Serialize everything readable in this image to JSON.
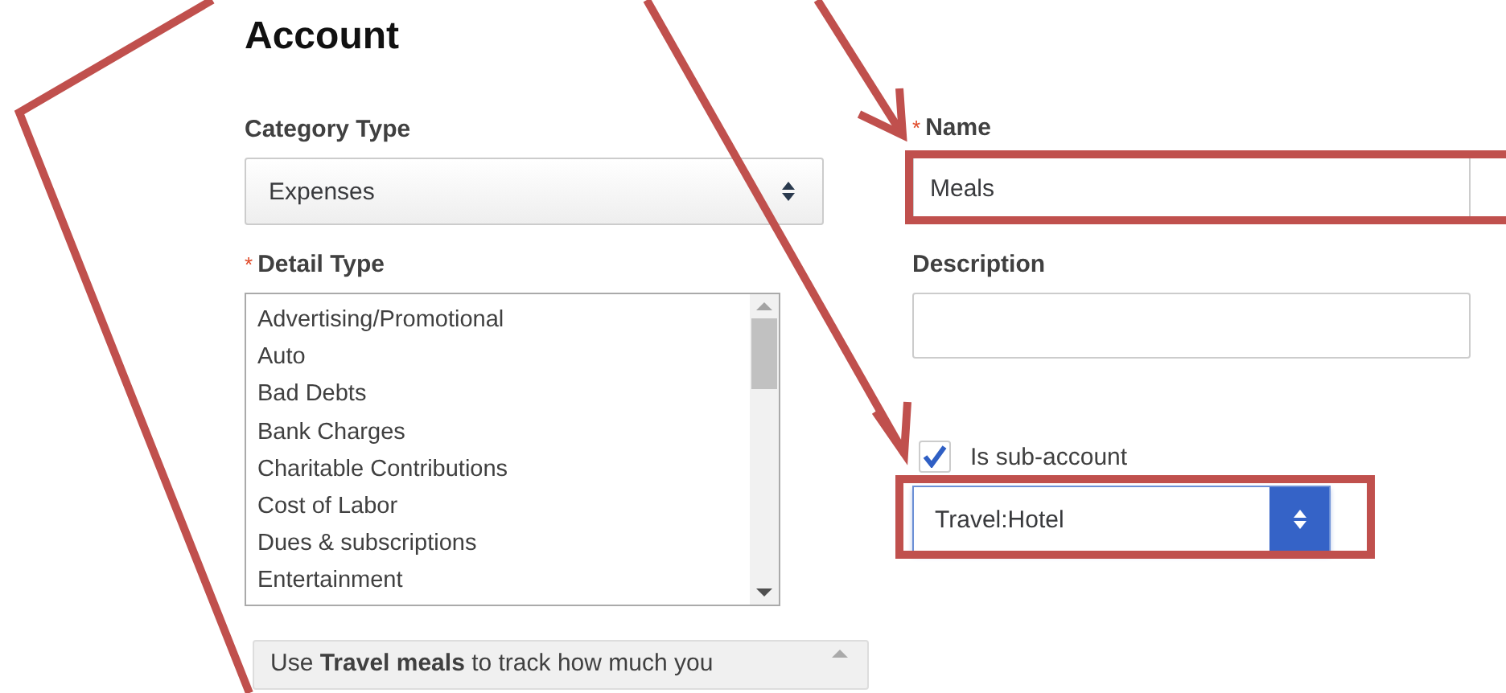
{
  "heading": "Account",
  "category_type": {
    "label": "Category Type",
    "value": "Expenses"
  },
  "detail_type": {
    "label": "Detail Type",
    "required_mark": "*",
    "items": [
      "Advertising/Promotional",
      "Auto",
      "Bad Debts",
      "Bank Charges",
      "Charitable Contributions",
      "Cost of Labor",
      "Dues & subscriptions",
      "Entertainment"
    ]
  },
  "help_text": "Use **Travel meals** to track how much you",
  "name": {
    "label": "Name",
    "required_mark": "*",
    "value": "Meals"
  },
  "description": {
    "label": "Description"
  },
  "sub_account": {
    "label": "Is sub-account",
    "checked": true,
    "parent": "Travel:Hotel"
  }
}
